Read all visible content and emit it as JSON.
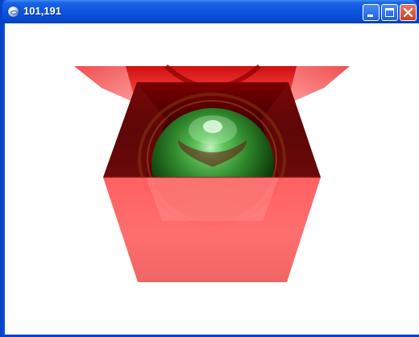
{
  "window": {
    "title": "101,191"
  },
  "titlebar_buttons": {
    "minimize": "minimize",
    "maximize": "maximize",
    "close": "close"
  },
  "scene": {
    "description_colors": {
      "box_front": "#ff6b6b",
      "box_interior": "#5a0000",
      "lid": "#e0282a",
      "sphere": "#3c9b3c"
    }
  }
}
